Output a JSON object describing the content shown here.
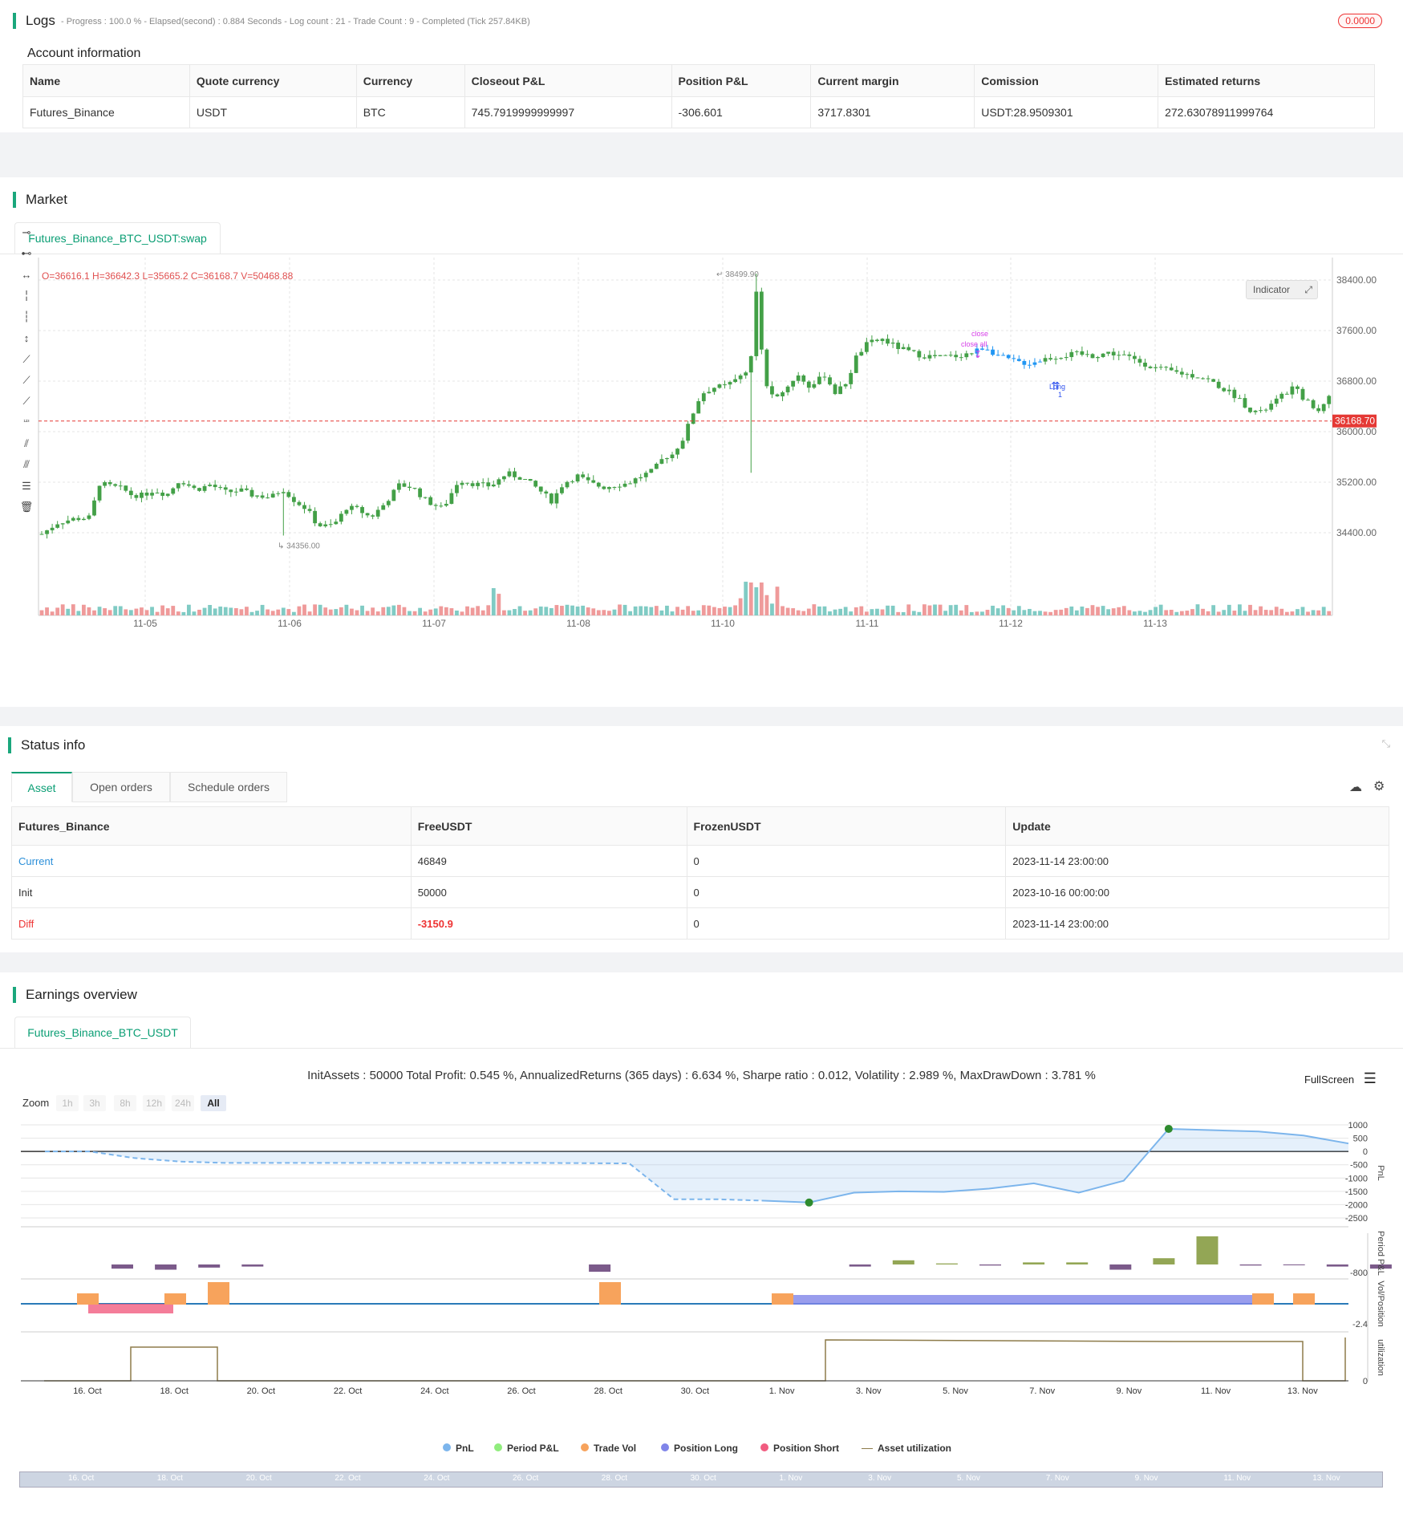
{
  "logs": {
    "title": "Logs",
    "summary": "- Progress : 100.0 % - Elapsed(second) : 0.884  Seconds - Log count : 21 - Trade Count : 9 - Completed (Tick 257.84KB)",
    "badge": "0.0000"
  },
  "account": {
    "title": "Account information",
    "headers": [
      "Name",
      "Quote currency",
      "Currency",
      "Closeout P&L",
      "Position P&L",
      "Current margin",
      "Comission",
      "Estimated returns"
    ],
    "row": [
      "Futures_Binance",
      "USDT",
      "BTC",
      "745.7919999999997",
      "-306.601",
      "3717.8301",
      "USDT:28.9509301",
      "272.63078911999764"
    ]
  },
  "market": {
    "title": "Market",
    "tab": "Futures_Binance_BTC_USDT:swap",
    "ohlc": "O=36616.1 H=36642.3 L=35665.2 C=36168.7 V=50468.88",
    "indicator_button": "Indicator",
    "last_price_label": "36168.70",
    "high_label": "38499.90",
    "low_label": "34356.00",
    "trade_labels": {
      "close": "close",
      "close_all": "close all",
      "long": "Long",
      "long_qty": "1"
    },
    "price_ticks": [
      "38400.00",
      "37600.00",
      "36800.00",
      "36000.00",
      "35200.00",
      "34400.00"
    ],
    "date_ticks": [
      "11-05",
      "11-06",
      "11-07",
      "11-08",
      "11-10",
      "11-11",
      "11-12",
      "11-13"
    ],
    "tools": [
      "horizontal-ray-icon",
      "horizontal-segment-icon",
      "horizontal-line-icon",
      "vertical-ray-icon",
      "vertical-segment-icon",
      "vertical-line-icon",
      "trend-ray-icon",
      "trend-segment-icon",
      "trend-line-icon",
      "price-label-icon",
      "parallel-channel-icon",
      "pitchfork-icon",
      "fibonacci-icon",
      "delete-icon"
    ]
  },
  "status": {
    "title": "Status info",
    "tabs": [
      "Asset",
      "Open orders",
      "Schedule orders"
    ],
    "headers": [
      "Futures_Binance",
      "FreeUSDT",
      "FrozenUSDT",
      "Update"
    ],
    "rows": [
      [
        "Current",
        "46849",
        "0",
        "2023-11-14 23:00:00"
      ],
      [
        "Init",
        "50000",
        "0",
        "2023-10-16 00:00:00"
      ],
      [
        "Diff",
        "-3150.9",
        "0",
        "2023-11-14 23:00:00"
      ]
    ]
  },
  "earnings": {
    "title": "Earnings overview",
    "tab": "Futures_Binance_BTC_USDT",
    "summary": "InitAssets : 50000 Total Profit: 0.545 %, AnnualizedReturns (365 days) : 6.634 %, Sharpe ratio : 0.012, Volatility : 2.989 %, MaxDrawDown : 3.781 %",
    "fullscreen": "FullScreen",
    "zoom_label": "Zoom",
    "zoom_options": [
      "1h",
      "3h",
      "8h",
      "12h",
      "24h",
      "All"
    ],
    "pnl_ticks": [
      "1000",
      "500",
      "0",
      "-500",
      "-1000",
      "-1500",
      "-2000",
      "-2500"
    ],
    "period_tick": "-800",
    "vol_tick": "-2.4",
    "util_tick": "0",
    "axis_titles": [
      "PnL",
      "Period P&L",
      "Vol/Position",
      "utilization"
    ],
    "date_ticks": [
      "16. Oct",
      "18. Oct",
      "20. Oct",
      "22. Oct",
      "24. Oct",
      "26. Oct",
      "28. Oct",
      "30. Oct",
      "1. Nov",
      "3. Nov",
      "5. Nov",
      "7. Nov",
      "9. Nov",
      "11. Nov",
      "13. Nov"
    ],
    "legend": [
      {
        "label": "PnL",
        "color": "#7cb5ec"
      },
      {
        "label": "Period P&L",
        "color": "#90ed7d"
      },
      {
        "label": "Trade Vol",
        "color": "#f7a35c"
      },
      {
        "label": "Position Long",
        "color": "#8085e9"
      },
      {
        "label": "Position Short",
        "color": "#f15c80"
      },
      {
        "label": "Asset utilization",
        "color": "#8d7b4a"
      }
    ]
  },
  "chart_data": {
    "type": "line",
    "title": "",
    "x": [
      "16. Oct",
      "17. Oct",
      "18. Oct",
      "19. Oct",
      "20. Oct",
      "21. Oct",
      "22. Oct",
      "23. Oct",
      "24. Oct",
      "25. Oct",
      "26. Oct",
      "27. Oct",
      "28. Oct",
      "29. Oct",
      "30. Oct",
      "31. Oct",
      "1. Nov",
      "2. Nov",
      "3. Nov",
      "4. Nov",
      "5. Nov",
      "6. Nov",
      "7. Nov",
      "8. Nov",
      "9. Nov",
      "10. Nov",
      "11. Nov",
      "12. Nov",
      "13. Nov",
      "14. Nov"
    ],
    "series": [
      {
        "name": "PnL",
        "values": [
          0,
          0,
          -250,
          -380,
          -430,
          -430,
          -430,
          -430,
          -430,
          -430,
          -430,
          -430,
          -440,
          -450,
          -1800,
          -1800,
          -1850,
          -1920,
          -1550,
          -1500,
          -1520,
          -1400,
          -1200,
          -1550,
          -1100,
          850,
          800,
          750,
          600,
          300
        ]
      }
    ],
    "ylim": [
      -2500,
      1000
    ],
    "grid": true,
    "legend_placement": "bottom"
  }
}
